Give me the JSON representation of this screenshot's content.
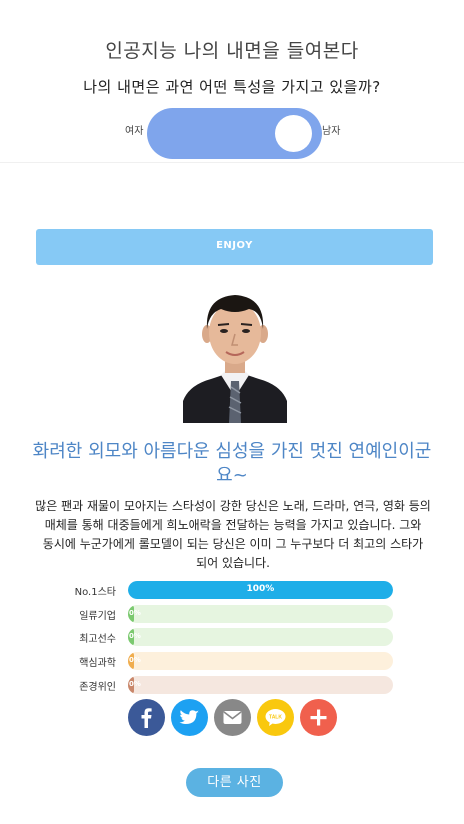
{
  "header": {
    "title": "인공지능 나의 내면을 들여본다",
    "subtitle": "나의 내면은 과연 어떤 특성을 가지고 있을까?"
  },
  "gender_toggle": {
    "left_label": "여자",
    "right_label": "남자",
    "selected": "남자",
    "color": "#7fa5ec"
  },
  "enjoy_button": {
    "label": "ENJOY",
    "color": "#86c9f5"
  },
  "result": {
    "title": "화려한 외모와 아름다운 심성을 가진 멋진 연예인이군요~",
    "description": "많은 팬과 재물이 모아지는 스타성이 강한 당신은 노래, 드라마, 연극, 영화 등의 매체를 통해 대중들에게 희노애락을 전달하는 능력을 가지고 있습니다. 그와 동시에 누군가에게 롤모델이 되는 당신은 이미 그 누구보다 더 최고의 스타가 되어 있습니다."
  },
  "stats": [
    {
      "label": "No.1스타",
      "percent": 100,
      "percent_text": "100%",
      "fill_color": "#1eaee8",
      "track_color": "#e3f3fb"
    },
    {
      "label": "일류기업",
      "percent": 2,
      "percent_text": "0%",
      "fill_color": "#7bc96f",
      "track_color": "#e6f5e0"
    },
    {
      "label": "최고선수",
      "percent": 2,
      "percent_text": "0%",
      "fill_color": "#7bc96f",
      "track_color": "#e6f5e0"
    },
    {
      "label": "핵심과학",
      "percent": 2,
      "percent_text": "0%",
      "fill_color": "#f0ad4e",
      "track_color": "#fdf0dc"
    },
    {
      "label": "존경위인",
      "percent": 2,
      "percent_text": "0%",
      "fill_color": "#c9876b",
      "track_color": "#f5e7df"
    }
  ],
  "share": [
    {
      "name": "facebook-icon",
      "color": "#3b5998"
    },
    {
      "name": "twitter-icon",
      "color": "#1da1f2"
    },
    {
      "name": "email-icon",
      "color": "#888888"
    },
    {
      "name": "kakaotalk-icon",
      "color": "#f9c80e",
      "text": "TALK"
    },
    {
      "name": "plus-icon",
      "color": "#f0604d"
    }
  ],
  "retry_button": {
    "label": "다른 사진",
    "color": "#5bb2e2"
  }
}
